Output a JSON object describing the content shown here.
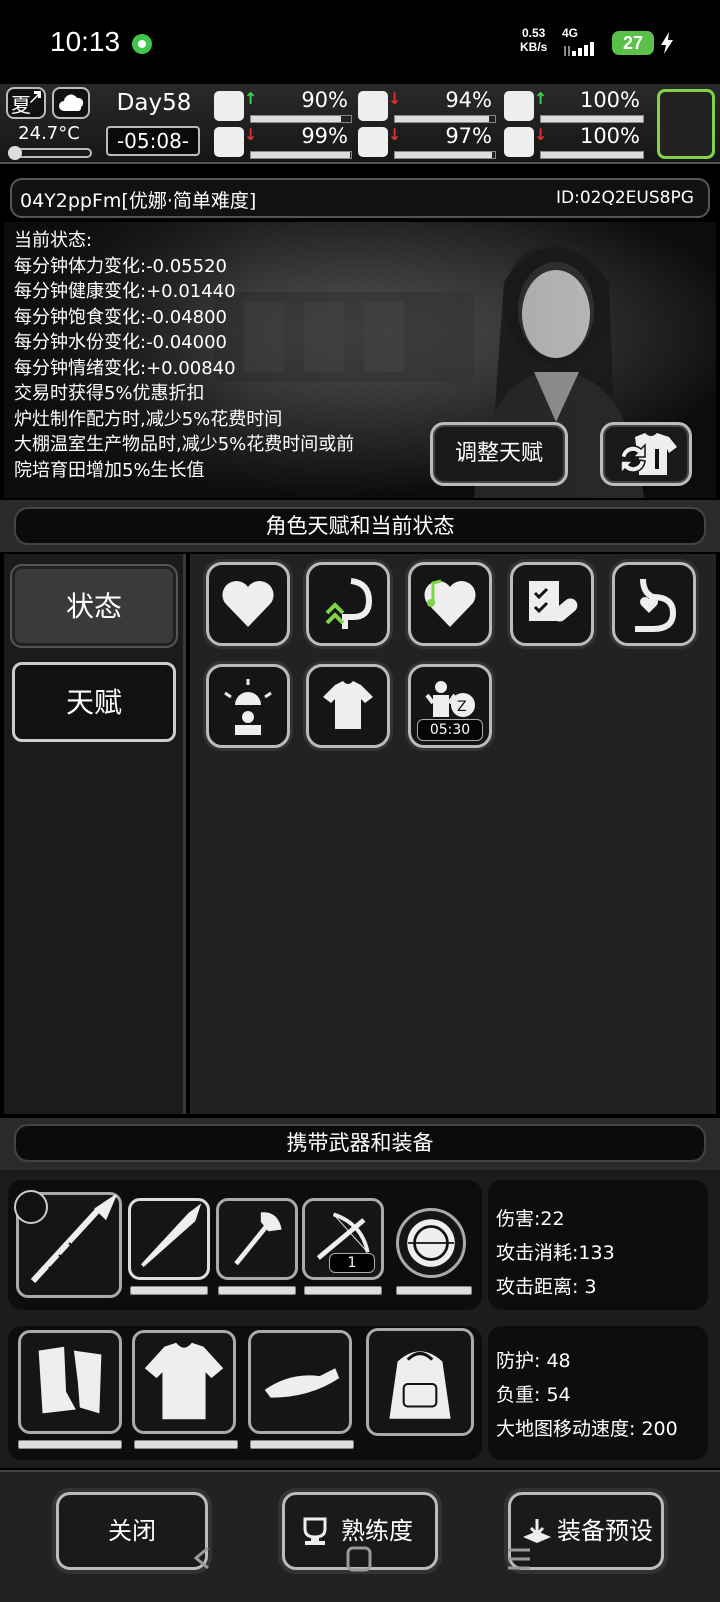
{
  "statusbar": {
    "time": "10:13",
    "net_speed_value": "0.53",
    "net_speed_unit": "KB/s",
    "network": "4G",
    "battery": "27"
  },
  "hud": {
    "season": "夏",
    "temperature": "24.7°C",
    "day": "Day58",
    "clock": "-05:08-",
    "vitals": [
      {
        "icon": "medkit-icon",
        "trend": "up",
        "percent": "90%",
        "level": 0.9
      },
      {
        "icon": "stomach-icon",
        "trend": "down",
        "percent": "94%",
        "level": 0.94
      },
      {
        "icon": "pill-icon",
        "trend": "up",
        "percent": "100%",
        "level": 1.0
      },
      {
        "icon": "boot-icon",
        "trend": "down",
        "percent": "99%",
        "level": 0.99
      },
      {
        "icon": "water-drop-icon",
        "trend": "down",
        "percent": "97%",
        "level": 0.97
      },
      {
        "icon": "heart-icon",
        "trend": "down",
        "percent": "100%",
        "level": 1.0
      }
    ],
    "colors": {
      "up": "#3fd35a",
      "down": "#e03030",
      "portrait_border": "#7fd44a"
    }
  },
  "character": {
    "name": "04Y2ppFm[优娜·简单难度]",
    "id": "ID:02Q2EUS8PG"
  },
  "status": {
    "heading": "当前状态:",
    "lines": [
      "每分钟体力变化:-0.05520",
      "每分钟健康变化:+0.01440",
      "每分钟饱食变化:-0.04800",
      "每分钟水份变化:-0.04000",
      "每分钟情绪变化:+0.00840",
      "交易时获得5%优惠折扣",
      "炉灶制作配方时,减少5%花费时间",
      "大棚温室生产物品时,减少5%花费时间或前",
      "院培育田增加5%生长值"
    ],
    "adjust_talent_label": "调整天赋"
  },
  "sections": {
    "talents_title": "角色天赋和当前状态",
    "equipment_title": "携带武器和装备"
  },
  "tabs": {
    "status": "状态",
    "talent": "天赋"
  },
  "talent_icons": [
    {
      "icon": "heart-icon"
    },
    {
      "icon": "stomach-boost-icon"
    },
    {
      "icon": "music-heart-icon"
    },
    {
      "icon": "medical-report-icon"
    },
    {
      "icon": "stomach-heart-icon"
    },
    {
      "icon": "alarm-person-icon"
    },
    {
      "icon": "shirt-icon"
    },
    {
      "icon": "sleep-icon",
      "timer": "05:30"
    }
  ],
  "weapons": {
    "main": "spear-icon",
    "slots": [
      "spear-icon",
      "axe-icon",
      "crossbow-icon",
      "shield-icon"
    ],
    "crossbow_count": "1",
    "stats": {
      "damage": "伤害:22",
      "attack_cost": "攻击消耗:133",
      "attack_range": "攻击距离: 3"
    }
  },
  "gear": {
    "slots": [
      "gloves-icon",
      "shirt-icon",
      "cap-icon",
      "backpack-icon"
    ],
    "stats": {
      "defense": "防护: 48",
      "weight": "负重: 54",
      "map_speed": "大地图移动速度: 200"
    }
  },
  "bottom": {
    "close": "关闭",
    "proficiency": "熟练度",
    "equip_preset": "装备预设"
  }
}
